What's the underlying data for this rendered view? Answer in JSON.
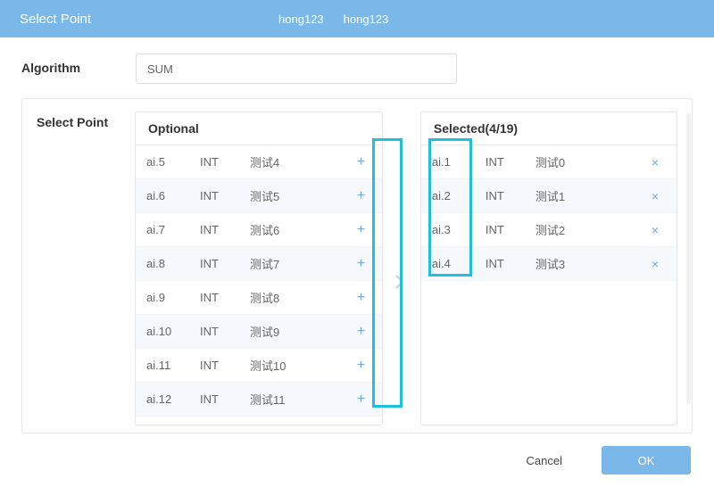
{
  "titlebar": {
    "title": "Select Point",
    "crumbs": [
      "hong123",
      "hong123"
    ]
  },
  "algorithm": {
    "label": "Algorithm",
    "value": "SUM"
  },
  "selectPoint": {
    "label": "Select Point",
    "optional": {
      "header": "Optional",
      "items": [
        {
          "id": "ai.5",
          "type": "INT",
          "desc": "测试4"
        },
        {
          "id": "ai.6",
          "type": "INT",
          "desc": "测试5"
        },
        {
          "id": "ai.7",
          "type": "INT",
          "desc": "测试6"
        },
        {
          "id": "ai.8",
          "type": "INT",
          "desc": "测试7"
        },
        {
          "id": "ai.9",
          "type": "INT",
          "desc": "测试8"
        },
        {
          "id": "ai.10",
          "type": "INT",
          "desc": "测试9"
        },
        {
          "id": "ai.11",
          "type": "INT",
          "desc": "测试10"
        },
        {
          "id": "ai.12",
          "type": "INT",
          "desc": "测试11"
        }
      ],
      "addGlyph": "+"
    },
    "selected": {
      "header": "Selected(4/19)",
      "items": [
        {
          "id": "ai.1",
          "type": "INT",
          "desc": "测试0"
        },
        {
          "id": "ai.2",
          "type": "INT",
          "desc": "测试1"
        },
        {
          "id": "ai.3",
          "type": "INT",
          "desc": "测试2"
        },
        {
          "id": "ai.4",
          "type": "INT",
          "desc": "测试3"
        }
      ],
      "removeGlyph": "×"
    }
  },
  "footer": {
    "cancel": "Cancel",
    "ok": "OK"
  }
}
